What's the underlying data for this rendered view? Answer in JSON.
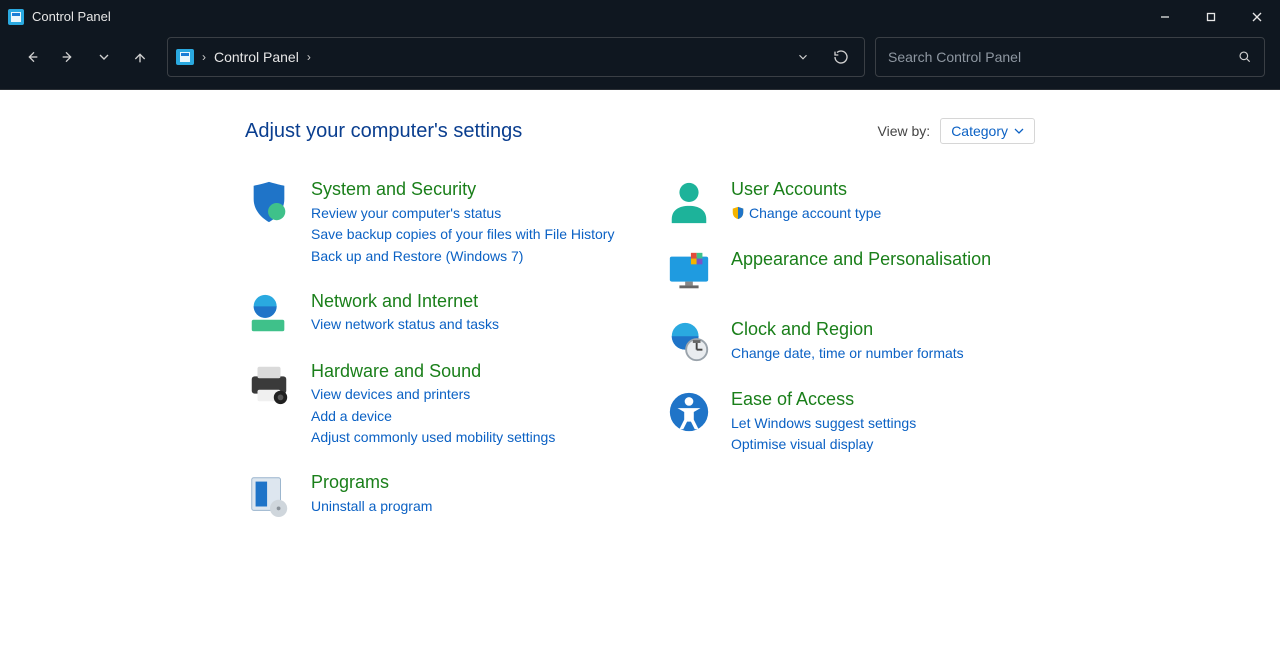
{
  "window": {
    "title": "Control Panel"
  },
  "breadcrumb": {
    "location": "Control Panel"
  },
  "search": {
    "placeholder": "Search Control Panel"
  },
  "header": {
    "title": "Adjust your computer's settings",
    "viewby_label": "View by:",
    "viewby_value": "Category"
  },
  "left": [
    {
      "title": "System and Security",
      "links": [
        {
          "label": "Review your computer's status",
          "shield": false
        },
        {
          "label": "Save backup copies of your files with File History",
          "shield": false
        },
        {
          "label": "Back up and Restore (Windows 7)",
          "shield": false
        }
      ]
    },
    {
      "title": "Network and Internet",
      "links": [
        {
          "label": "View network status and tasks",
          "shield": false
        }
      ]
    },
    {
      "title": "Hardware and Sound",
      "links": [
        {
          "label": "View devices and printers",
          "shield": false
        },
        {
          "label": "Add a device",
          "shield": false
        },
        {
          "label": "Adjust commonly used mobility settings",
          "shield": false
        }
      ]
    },
    {
      "title": "Programs",
      "links": [
        {
          "label": "Uninstall a program",
          "shield": false
        }
      ]
    }
  ],
  "right": [
    {
      "title": "User Accounts",
      "links": [
        {
          "label": "Change account type",
          "shield": true
        }
      ]
    },
    {
      "title": "Appearance and Personalisation",
      "links": []
    },
    {
      "title": "Clock and Region",
      "links": [
        {
          "label": "Change date, time or number formats",
          "shield": false
        }
      ]
    },
    {
      "title": "Ease of Access",
      "links": [
        {
          "label": "Let Windows suggest settings",
          "shield": false
        },
        {
          "label": "Optimise visual display",
          "shield": false
        }
      ]
    }
  ]
}
